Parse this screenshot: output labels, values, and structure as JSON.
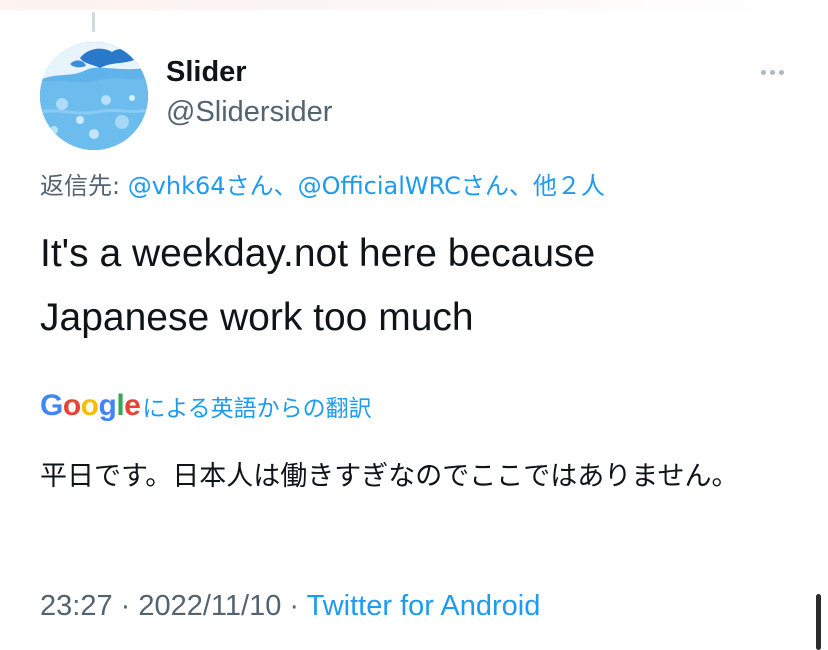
{
  "author": {
    "display_name": "Slider",
    "handle": "@Slidersider"
  },
  "reply": {
    "prefix": "返信先: ",
    "mention_1": "@vhk64",
    "san_1": "さん、",
    "mention_2": "@OfficialWRC",
    "san_2": "さん、",
    "others": "他２人"
  },
  "tweet": {
    "line_1": "It's a weekday.not here because",
    "line_2": "Japanese work too much"
  },
  "translation": {
    "brand_letters": [
      "G",
      "o",
      "o",
      "g",
      "l",
      "e"
    ],
    "label": "による英語からの翻訳",
    "text": "平日です。日本人は働きすぎなのでここではありません。"
  },
  "meta": {
    "time": "23:27",
    "separator": " · ",
    "date": "2022/11/10",
    "source": "Twitter for Android"
  },
  "icons": {
    "more": "more-horizontal-icon",
    "avatar": "avatar-image"
  },
  "colors": {
    "link": "#1d9bf0",
    "muted": "#536471",
    "text": "#0f1419"
  }
}
